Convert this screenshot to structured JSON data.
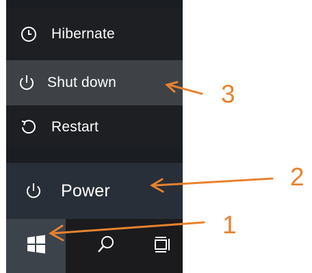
{
  "power_menu": {
    "items": [
      {
        "label": "Hibernate",
        "icon": "clock-icon"
      },
      {
        "label": "Shut down",
        "icon": "power-icon"
      },
      {
        "label": "Restart",
        "icon": "restart-icon"
      }
    ]
  },
  "start_menu": {
    "power_label": "Power",
    "power_icon": "power-icon"
  },
  "taskbar": {
    "start_icon": "windows-logo-icon",
    "search_icon": "search-icon",
    "taskview_icon": "task-view-icon"
  },
  "annotations": {
    "step1": "1",
    "step2": "2",
    "step3": "3",
    "color": "#e8822e"
  }
}
